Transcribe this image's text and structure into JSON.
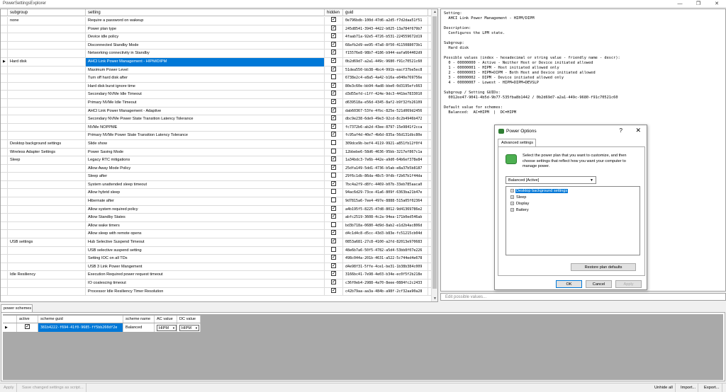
{
  "window": {
    "title": "PowerSettingsExplorer",
    "minimize": "—",
    "maximize": "❐",
    "close": "✕"
  },
  "grid": {
    "headers": {
      "subgroup": "subgroup",
      "setting": "setting",
      "hidden": "hidden",
      "guid": "guid"
    },
    "rows": [
      {
        "subgroup": "none",
        "setting": "Require a password on wakeup",
        "hidden": true,
        "guid": "0e796bdb-100d-47d6-a2d5-f7d2daa51f51",
        "indicator": ""
      },
      {
        "subgroup": "",
        "setting": "Power plan type",
        "hidden": true,
        "guid": "245d8541-3943-4422-b025-13a784f679b7",
        "indicator": ""
      },
      {
        "subgroup": "",
        "setting": "Device idle policy",
        "hidden": true,
        "guid": "4faab71a-92e5-4726-b531-224559672d19",
        "indicator": ""
      },
      {
        "subgroup": "",
        "setting": "Disconnected Standby Mode",
        "hidden": true,
        "guid": "68afb2d9-ee95-47a8-8f50-4115088073b1",
        "indicator": ""
      },
      {
        "subgroup": "",
        "setting": "Networking connectivity in Standby",
        "hidden": true,
        "guid": "f15576e8-98b7-4186-b944-eafa664402d9",
        "indicator": ""
      },
      {
        "subgroup": "Hard disk",
        "setting": "AHCI Link Power Management - HIPM/DIPM",
        "hidden": true,
        "guid": "0b2d69d7-a2a1-449c-9680-f91c70521c60",
        "indicator": "▶",
        "selected": true
      },
      {
        "subgroup": "",
        "setting": "Maximum Power Level",
        "hidden": true,
        "guid": "51dea550-bb38-4bc4-991b-eacf37be5ec8",
        "indicator": ""
      },
      {
        "subgroup": "",
        "setting": "Turn off hard disk after",
        "hidden": false,
        "guid": "6738e2c4-e8a5-4a42-b16a-e040e769756e",
        "indicator": ""
      },
      {
        "subgroup": "",
        "setting": "Hard disk burst ignore time",
        "hidden": true,
        "guid": "80e3c60e-bb94-4ad8-bbe0-0d3195efc663",
        "indicator": ""
      },
      {
        "subgroup": "",
        "setting": "Secondary NVMe Idle Timeout",
        "hidden": true,
        "guid": "d3d55efd-c1ff-424e-9dc3-441be7833010",
        "indicator": ""
      },
      {
        "subgroup": "",
        "setting": "Primary NVMe Idle Timeout",
        "hidden": true,
        "guid": "d639518a-e56d-4345-8af2-b9f32fb26109",
        "indicator": ""
      },
      {
        "subgroup": "",
        "setting": "AHCI Link Power Management - Adaptive",
        "hidden": true,
        "guid": "dab60367-53fe-4fbc-825e-521d069d2456",
        "indicator": ""
      },
      {
        "subgroup": "",
        "setting": "Secondary NVMe Power State Transition Latency Tolerance",
        "hidden": true,
        "guid": "dbc9e238-6de9-49e3-92cd-8c2b4946b472",
        "indicator": ""
      },
      {
        "subgroup": "",
        "setting": "NVMe NOPPME",
        "hidden": true,
        "guid": "fc7372b6-ab2d-43ee-8797-15e9841f2cca",
        "indicator": ""
      },
      {
        "subgroup": "",
        "setting": "Primary NVMe Power State Transition Latency Tolerance",
        "hidden": true,
        "guid": "fc95af4d-40e7-4b6d-835a-56d131dbc80e",
        "indicator": ""
      },
      {
        "subgroup": "Desktop background settings",
        "setting": "Slide show",
        "hidden": false,
        "guid": "309dce9b-bef4-4119-9921-a851fb12f0f4",
        "indicator": ""
      },
      {
        "subgroup": "Wireless Adapter Settings",
        "setting": "Power Saving Mode",
        "hidden": false,
        "guid": "12bbebe6-58d6-4636-95bb-3217ef867c1a",
        "indicator": ""
      },
      {
        "subgroup": "Sleep",
        "setting": "Legacy RTC mitigations",
        "hidden": true,
        "guid": "1a34bdc3-7e6b-442e-a9d0-64b6ef378e84",
        "indicator": ""
      },
      {
        "subgroup": "",
        "setting": "Allow Away Mode Policy",
        "hidden": true,
        "guid": "25dfa149-5dd1-4736-b5ab-e8a37b5b8187",
        "indicator": ""
      },
      {
        "subgroup": "",
        "setting": "Sleep after",
        "hidden": false,
        "guid": "29f6c1db-86da-48c5-9fdb-f2b67b1f44da",
        "indicator": ""
      },
      {
        "subgroup": "",
        "setting": "System unattended sleep timeout",
        "hidden": true,
        "guid": "7bc4a2f9-d8fc-4469-b07b-33eb785aaca0",
        "indicator": ""
      },
      {
        "subgroup": "",
        "setting": "Allow hybrid sleep",
        "hidden": false,
        "guid": "94ac6d29-73ce-41a6-809f-6363ba21b47e",
        "indicator": ""
      },
      {
        "subgroup": "",
        "setting": "Hibernate after",
        "hidden": false,
        "guid": "9d7815a6-7ee4-497e-8888-515a05f02364",
        "indicator": ""
      },
      {
        "subgroup": "",
        "setting": "Allow system required policy",
        "hidden": true,
        "guid": "a4b195f5-8225-47d8-8012-9d41369786e2",
        "indicator": ""
      },
      {
        "subgroup": "",
        "setting": "Allow Standby States",
        "hidden": true,
        "guid": "abfc2519-3608-4c2a-94ea-171b0ed546ab",
        "indicator": ""
      },
      {
        "subgroup": "",
        "setting": "Allow wake timers",
        "hidden": false,
        "guid": "bd3b718a-0680-4d9d-8ab2-e1d2b4ac806d",
        "indicator": ""
      },
      {
        "subgroup": "",
        "setting": "Allow sleep with remote opens",
        "hidden": true,
        "guid": "d4c1d4c8-d5cc-43d3-b83e-fc51215cb04d",
        "indicator": ""
      },
      {
        "subgroup": "USB settings",
        "setting": "Hub Selective Suspend Timeout",
        "hidden": true,
        "guid": "0853a681-27c8-4100-a2fd-82013e970683",
        "indicator": ""
      },
      {
        "subgroup": "",
        "setting": "USB selective suspend setting",
        "hidden": false,
        "guid": "48e6b7a6-50f5-4782-a5d4-53bb8f07e226",
        "indicator": ""
      },
      {
        "subgroup": "",
        "setting": "Setting IOC on all TDs",
        "hidden": true,
        "guid": "498c044a-201b-4631-a522-5c744ed4e678",
        "indicator": ""
      },
      {
        "subgroup": "",
        "setting": "USB 3 Link Power Mangement",
        "hidden": true,
        "guid": "d4e98f31-5ffe-4ce1-be31-1b38b384c009",
        "indicator": ""
      },
      {
        "subgroup": "Idle Resiliency",
        "setting": "Execution Required power request timeout",
        "hidden": true,
        "guid": "3166bc41-7e98-4e03-b34e-ec0f5f2b218e",
        "indicator": ""
      },
      {
        "subgroup": "",
        "setting": "IO coalescing timeout",
        "hidden": true,
        "guid": "c36f0eb4-2988-4a70-8eee-0884fc2c2433",
        "indicator": ""
      },
      {
        "subgroup": "",
        "setting": "Processor Idle Resiliency Timer Resolution",
        "hidden": true,
        "guid": "c42b79aa-aa3a-484b-a98f-2cf32aa90a28",
        "indicator": ""
      }
    ]
  },
  "description": "Setting:\n  AHCI Link Power Management - HIPM/DIPM\n\nDescription:\n  Configures the LPM state.\n\nSubgroup:\n  Hard disk\n\nPossible values (index - hexadecimal or string value - friendly name - descr):\n  0 - 00000000 - Active - Neither Host or Device initiated allowed\n  1 - 00000001 - HIPM - Host initiated allowed only\n  2 - 00000003 - HIPM+DIPM - Both Host and Device initiated allowed\n  3 - 00000002 - DIPM - Device initiated allowed only\n  4 - 00000007 - Lowest - HIPM+DIPM+DEVSLP\n\nSubgroup / Setting GUIDs:\n  0012ee47-9041-4b5d-9b77-535fba8b1442 / 0b2d69d7-a2a1-449c-9680-f91c70521c60\n\nDefault value for schemes:\n  Balanced:  AC=HIPM  |  DC=HIPM",
  "edit_placeholder": "Edit possible values...",
  "dialog": {
    "title": "Power Options",
    "help": "?",
    "close": "✕",
    "tab": "Advanced settings",
    "instructions": "Select the power plan that you want to customize, and then choose settings that reflect how you want your computer to manage power.",
    "plan_selected": "Balanced [Active]",
    "tree": [
      "Desktop background settings",
      "Sleep",
      "Display",
      "Battery"
    ],
    "restore": "Restore plan defaults",
    "ok": "OK",
    "cancel": "Cancel",
    "apply": "Apply"
  },
  "schemes": {
    "tab": "power schemes",
    "headers": {
      "active": "active",
      "guid": "scheme guid",
      "name": "scheme name",
      "ac": "AC value",
      "dc": "DC value"
    },
    "row": {
      "active": true,
      "guid": "381b4222-f694-41f0-9685-ff5bb260df2e",
      "name": "Balanced",
      "ac": "HIPM",
      "dc": "HIPM"
    }
  },
  "status": {
    "apply": "Apply",
    "save": "Save changed settings as script...",
    "unhide": "Unhide all",
    "import": "Import...",
    "export": "Export..."
  }
}
